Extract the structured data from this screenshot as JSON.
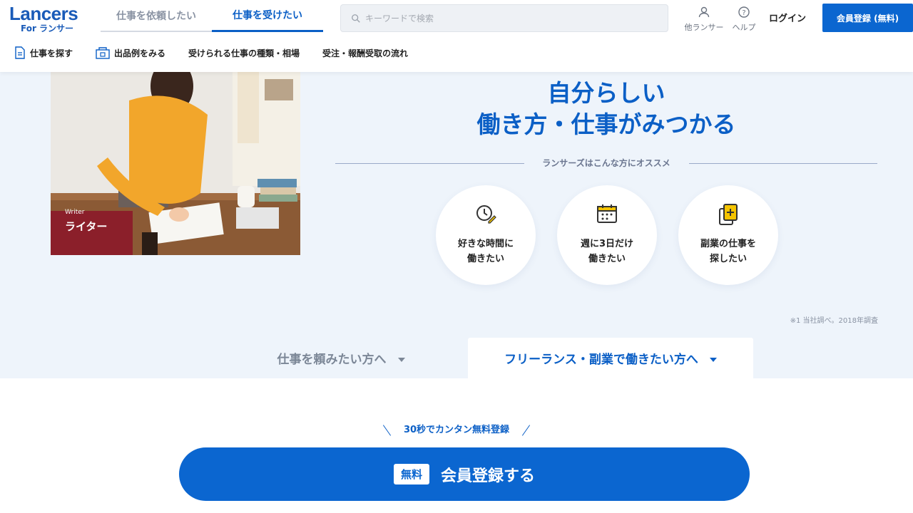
{
  "header": {
    "logo_main": "Lancers",
    "logo_sub": "For ランサー",
    "tabs": [
      {
        "label": "仕事を依頼したい"
      },
      {
        "label": "仕事を受けたい"
      }
    ],
    "search_placeholder": "キーワードで検索",
    "icons": [
      {
        "label": "他ランサー",
        "icon": "person-icon"
      },
      {
        "label": "ヘルプ",
        "icon": "help-icon"
      }
    ],
    "login_label": "ログイン",
    "register_label": "会員登録 (無料)"
  },
  "subnav": [
    {
      "label": "仕事を探す",
      "icon": "document-icon"
    },
    {
      "label": "出品例をみる",
      "icon": "shop-icon"
    },
    {
      "label": "受けられる仕事の種類・相場"
    },
    {
      "label": "受注・報酬受取の流れ"
    }
  ],
  "hero": {
    "photo_caption_en": "Writer",
    "photo_caption_jp": "ライター",
    "headline_line1": "自分らしい",
    "headline_line2": "働き方・仕事がみつかる",
    "recommend_label": "ランサーズはこんな方にオススメ",
    "circles": [
      {
        "line1": "好きな時間に",
        "line2": "働きたい",
        "icon": "clock-pen-icon"
      },
      {
        "line1": "週に3日だけ",
        "line2": "働きたい",
        "icon": "calendar-icon"
      },
      {
        "line1": "副業の仕事を",
        "line2": "探したい",
        "icon": "add-document-icon"
      }
    ],
    "note": "※1 当社調べ。2018年調査",
    "tab_client": "仕事を頼みたい方へ",
    "tab_freelance": "フリーランス・副業で働きたい方へ"
  },
  "cta": {
    "note": "30秒でカンタン無料登録",
    "badge": "無料",
    "button_label": "会員登録する"
  },
  "colors": {
    "primary": "#0b66d0",
    "hero_bg": "#eef4fb"
  }
}
